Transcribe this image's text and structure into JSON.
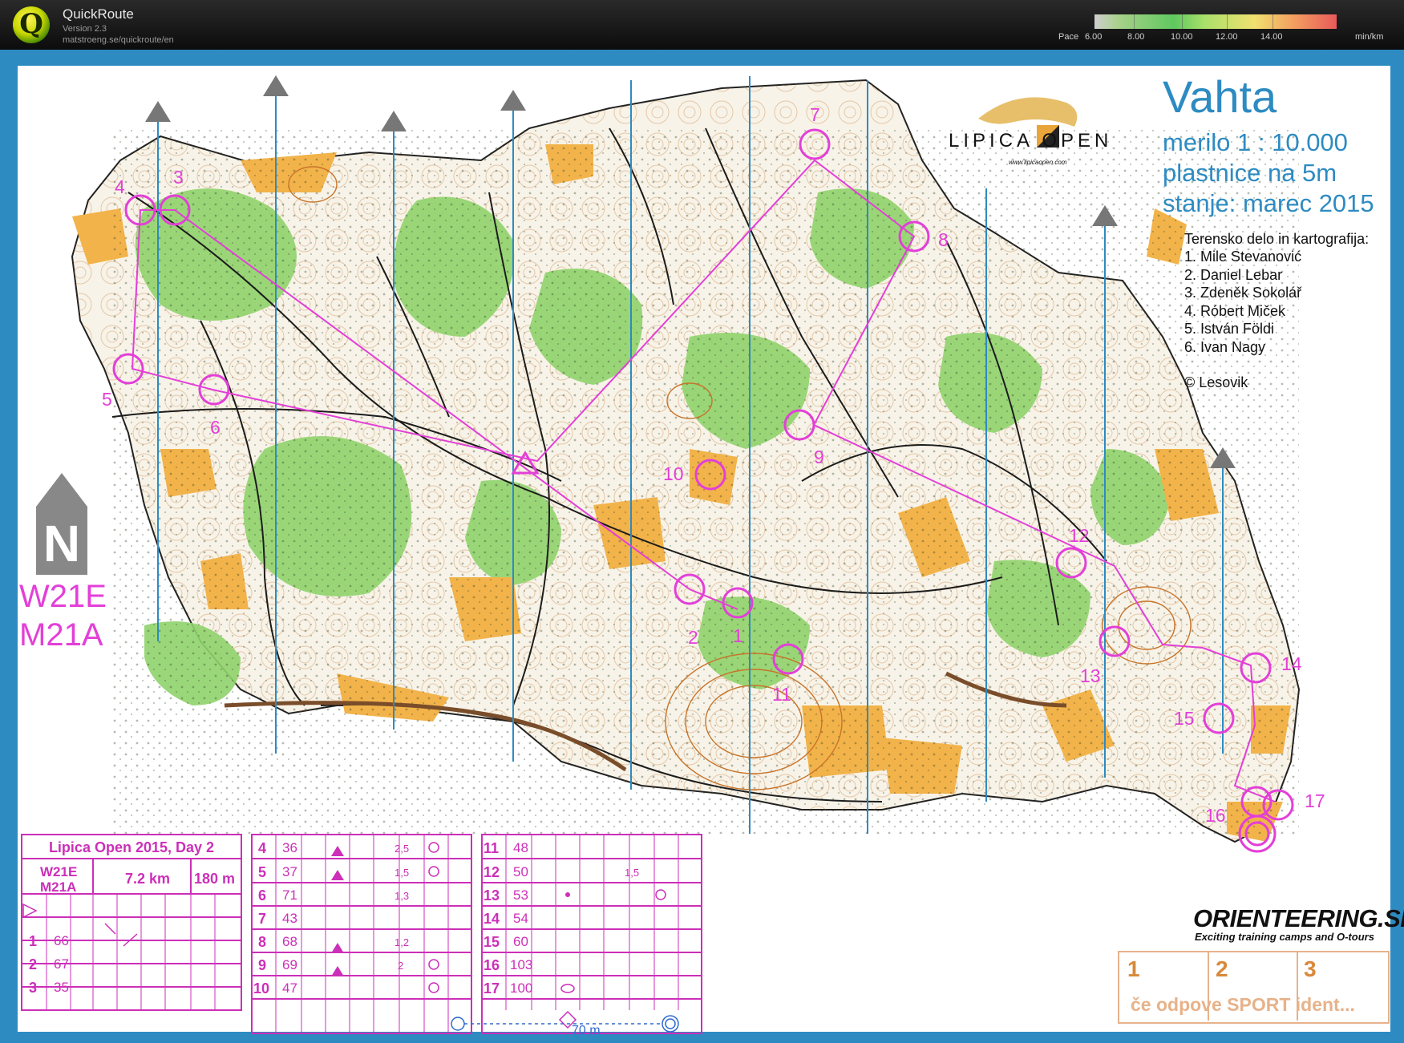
{
  "app": {
    "name": "QuickRoute",
    "version": "Version 2.3",
    "url": "matstroeng.se/quickroute/en",
    "logo_letter": "Q",
    "pace_label": "Pace",
    "pace_ticks": [
      "6.00",
      "8.00",
      "10.00",
      "12.00",
      "14.00"
    ],
    "pace_unit": "min/km"
  },
  "map": {
    "title": "Vahta",
    "scale": "merilo 1 : 10.000",
    "contours": "plastnice na 5m",
    "status": "stanje: marec 2015",
    "credits_heading": "Terensko delo in kartografija:",
    "credits": [
      "1. Mile Stevanović",
      "2. Daniel Lebar",
      "3. Zdeněk Sokolář",
      "4. Róbert Miček",
      "5. István Földi",
      "6. Ivan Nagy"
    ],
    "copyright": "© Lesovik",
    "event_logo_text": "LIPICA OPEN",
    "event_logo_url": "www.lipicaopen.com",
    "course_class": [
      "W21E",
      "M21A"
    ],
    "control_numbers": [
      "1",
      "2",
      "3",
      "4",
      "5",
      "6",
      "7",
      "8",
      "9",
      "10",
      "11",
      "12",
      "13",
      "14",
      "15",
      "16",
      "17"
    ],
    "north_symbol": "N",
    "colors": {
      "frame": "#2d8bc2",
      "course": "#e33fd8",
      "forest": "#8fd36c",
      "open": "#f2b34a",
      "contours": "#c8742a"
    }
  },
  "description_sheet": {
    "event": "Lipica Open 2015, Day 2",
    "classes": [
      "W21E",
      "M21A"
    ],
    "length": "7.2 km",
    "climb": "180 m",
    "rows": [
      {
        "no": "1",
        "code": "66"
      },
      {
        "no": "2",
        "code": "67"
      },
      {
        "no": "3",
        "code": "35"
      },
      {
        "no": "4",
        "code": "36",
        "dim": "2,5"
      },
      {
        "no": "5",
        "code": "37",
        "dim": "1,5"
      },
      {
        "no": "6",
        "code": "71",
        "dim": "1,3"
      },
      {
        "no": "7",
        "code": "43"
      },
      {
        "no": "8",
        "code": "68",
        "dim": "1,2"
      },
      {
        "no": "9",
        "code": "69",
        "dim": "2"
      },
      {
        "no": "10",
        "code": "47"
      },
      {
        "no": "11",
        "code": "48"
      },
      {
        "no": "12",
        "code": "50",
        "dim": "1,5"
      },
      {
        "no": "13",
        "code": "53"
      },
      {
        "no": "14",
        "code": "54"
      },
      {
        "no": "15",
        "code": "60"
      },
      {
        "no": "16",
        "code": "103"
      },
      {
        "no": "17",
        "code": "100"
      }
    ],
    "finish_distance": "70 m"
  },
  "ad": {
    "brand": "ORIENTEERING.SI",
    "tagline": "Exciting training camps and O-tours",
    "sport_numbers": [
      "1",
      "2",
      "3"
    ],
    "sport_text": "če odpove SPORT ident..."
  }
}
